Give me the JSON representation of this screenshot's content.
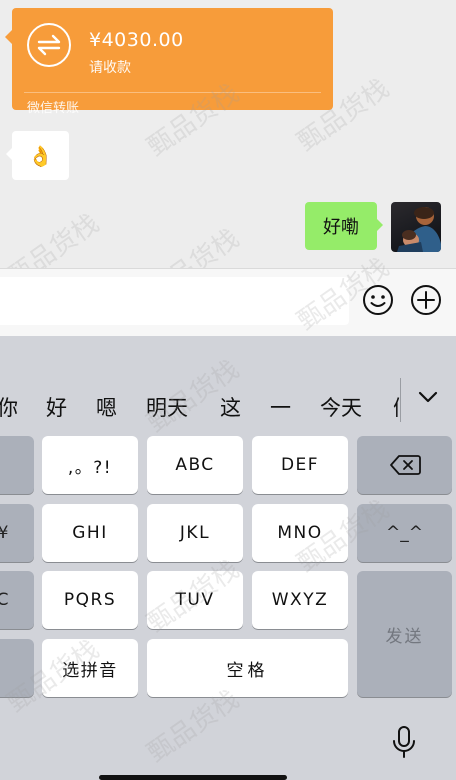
{
  "chat": {
    "transfer": {
      "amount": "¥4030.00",
      "status": "请收款",
      "footer": "微信转账",
      "icon": "transfer-arrows-icon"
    },
    "received_emoji": "👌",
    "sent_text": "好嘞"
  },
  "input_bar": {
    "value": "",
    "emoji_icon": "smiley-icon",
    "more_icon": "plus-circle-icon"
  },
  "keyboard": {
    "candidates": [
      "你",
      "好",
      "嗯",
      "明天",
      "这",
      "一",
      "今天",
      "们"
    ],
    "left_partial": [
      "",
      "¥",
      "C",
      ""
    ],
    "keys": {
      "punct": ",。?!",
      "abc": "ABC",
      "def": "DEF",
      "ghi": "GHI",
      "jkl": "JKL",
      "mno": "MNO",
      "pqrs": "PQRS",
      "tuv": "TUV",
      "wxyz": "WXYZ",
      "pinyin": "选拼音",
      "space": "空格",
      "emoticon": "^_^",
      "send": "发送"
    },
    "icons": {
      "backspace": "backspace-icon",
      "expand": "chevron-down-icon",
      "mic": "microphone-icon"
    }
  },
  "watermark": "甄品货栈",
  "colors": {
    "transfer_bg": "#f79c3a",
    "sent_bubble": "#95ec69",
    "chat_bg": "#ededed",
    "keyboard_bg": "#d1d3d9",
    "gray_key": "#abb0ba"
  }
}
